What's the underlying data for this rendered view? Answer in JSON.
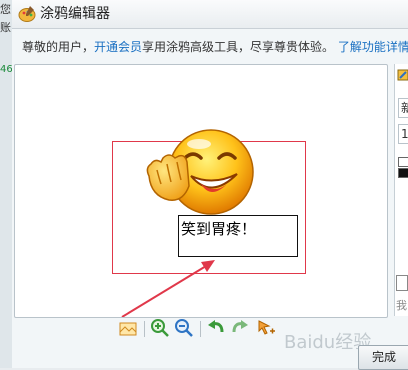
{
  "left_strip": {
    "chars": [
      "您",
      "账",
      "46"
    ]
  },
  "window": {
    "title": "涂鸦编辑器",
    "title_icon": "paint-palette-icon"
  },
  "notice": {
    "prefix": "尊敬的用户，",
    "link_vip": "开通会员",
    "middle": "享用涂鸦高级工具，尽享尊贵体验。",
    "link_more": "了解功能详情"
  },
  "canvas": {
    "sticker": "laughing-face-sticker",
    "text_content": "笑到胃疼！"
  },
  "toolbar": {
    "items": [
      "image-icon",
      "zoom-in-icon",
      "zoom-out-icon",
      "undo-icon",
      "redo-icon",
      "move-icon"
    ]
  },
  "side_panel": {
    "field1_value": "新",
    "field2_value": "1",
    "bottom_text": "我"
  },
  "footer": {
    "done_label": "完成"
  },
  "watermark": {
    "text": "Baidu经验"
  },
  "colors": {
    "link": "#1a70c2",
    "selection_border": "#e0384a",
    "arrow": "#e0384a",
    "background": "#f2f6f8"
  }
}
